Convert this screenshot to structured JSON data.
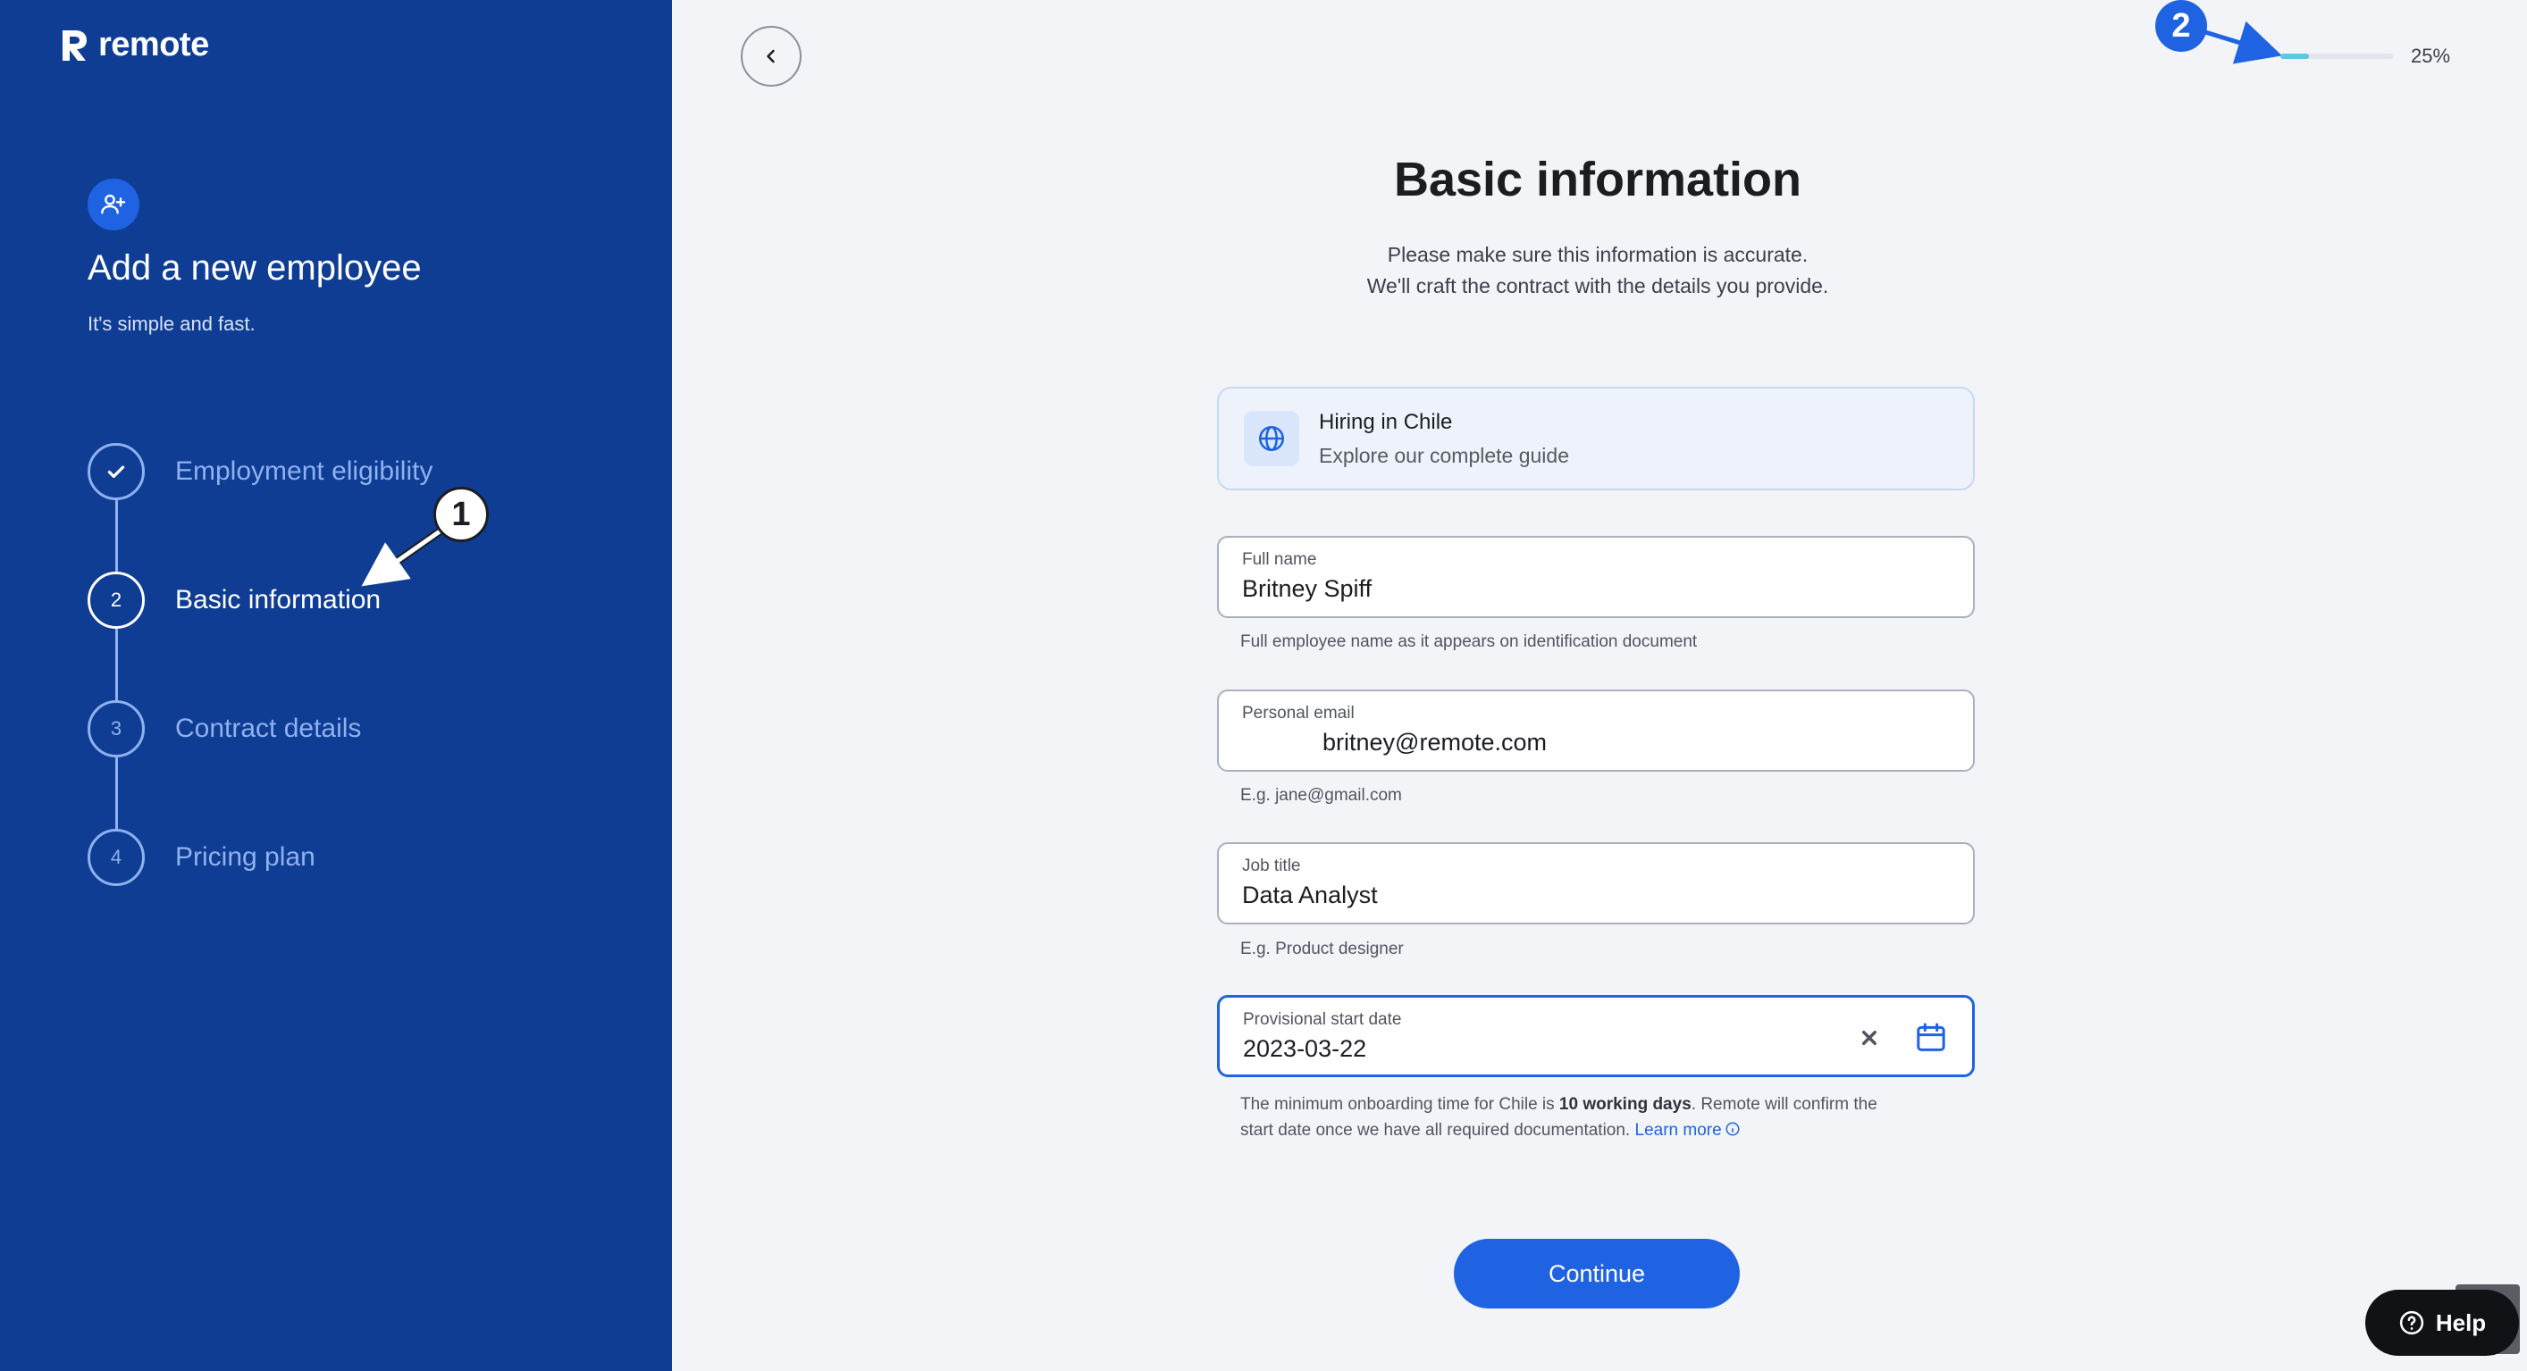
{
  "brand": {
    "name": "remote"
  },
  "sidebar": {
    "title": "Add a new employee",
    "subtitle": "It's simple and fast.",
    "steps": [
      {
        "number": "",
        "label": "Employment eligibility",
        "state": "completed"
      },
      {
        "number": "2",
        "label": "Basic information",
        "state": "active"
      },
      {
        "number": "3",
        "label": "Contract details",
        "state": "upcoming"
      },
      {
        "number": "4",
        "label": "Pricing plan",
        "state": "upcoming"
      }
    ]
  },
  "annotations": {
    "marker1": "1",
    "marker2": "2"
  },
  "progress": {
    "percent": 25,
    "label": "25%"
  },
  "main": {
    "title": "Basic information",
    "subtitle_line1": "Please make sure this information is accurate.",
    "subtitle_line2": "We'll craft the contract with the details you provide."
  },
  "guide_card": {
    "title": "Hiring in Chile",
    "subtitle": "Explore our complete guide"
  },
  "form": {
    "full_name": {
      "label": "Full name",
      "value": "Britney Spiff",
      "helper": "Full employee name as it appears on identification document"
    },
    "personal_email": {
      "label": "Personal email",
      "value": "britney@remote.com",
      "helper": "E.g. jane@gmail.com"
    },
    "job_title": {
      "label": "Job title",
      "value": "Data Analyst",
      "helper": "E.g. Product designer"
    },
    "start_date": {
      "label": "Provisional start date",
      "value": "2023-03-22",
      "helper_pre": "The minimum onboarding time for Chile is ",
      "helper_bold": "10 working days",
      "helper_post": ". Remote will confirm the",
      "helper_line2": "start date once we have all required documentation. ",
      "helper_link": "Learn more"
    }
  },
  "buttons": {
    "continue": "Continue",
    "help": "Help"
  },
  "colors": {
    "sidebar_bg": "#0f3d93",
    "accent": "#1f63e3",
    "progress": "#5ac8e6"
  }
}
